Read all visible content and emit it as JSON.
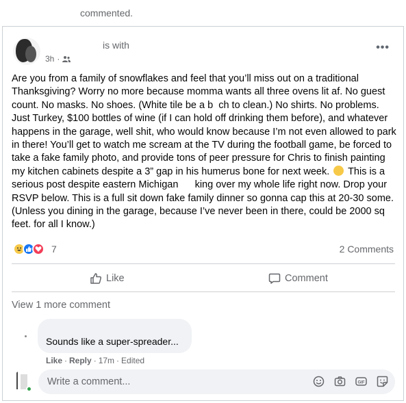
{
  "top_note": {
    "text": "commented."
  },
  "post": {
    "author_suffix": "is with",
    "time": "3h",
    "audience_icon": "friends-icon",
    "text_before_emoji": "Are you from a family of snowflakes and feel that you’ll miss out on a traditional Thanksgiving? Worry no more because momma wants all three ovens lit af. No guest count. No masks. No shoes. (White tile be a b  ch to clean.) No shirts. No problems. Just Turkey, $100 bottles of wine (if I can hold off drinking them before), and whatever happens in the garage, well shit, who would know because I’m not even allowed to park in there! You’ll get to watch me scream at the TV during the football game, be forced to take a fake family photo, and provide tons of peer pressure for Chris to finish painting my kitchen cabinets despite a 3” gap in his humerus bone for next week.",
    "text_after_emoji": " This is a serious post despite eastern Michigan      king over my whole life right now. Drop your RSVP below. This is a full sit down fake family dinner so gonna cap this at 20-30 some. (Unless you dining in the garage, because I’ve never been in there, could be 2000 sq feet. for all I know.)",
    "reaction_count": "7",
    "comments_count": "2 Comments"
  },
  "actions": {
    "like": "Like",
    "comment": "Comment"
  },
  "view_more": "View 1 more comment",
  "comment": {
    "text": "Sounds like a super-spreader...",
    "like": "Like",
    "reply": "Reply",
    "time": "17m",
    "edited": "Edited"
  },
  "write_comment": {
    "placeholder": "Write a comment..."
  },
  "colors": {
    "like_blue": "#1877f2",
    "love_red": "#f33e58",
    "haha_yellow": "#f7c948",
    "online_green": "#31a24c"
  }
}
